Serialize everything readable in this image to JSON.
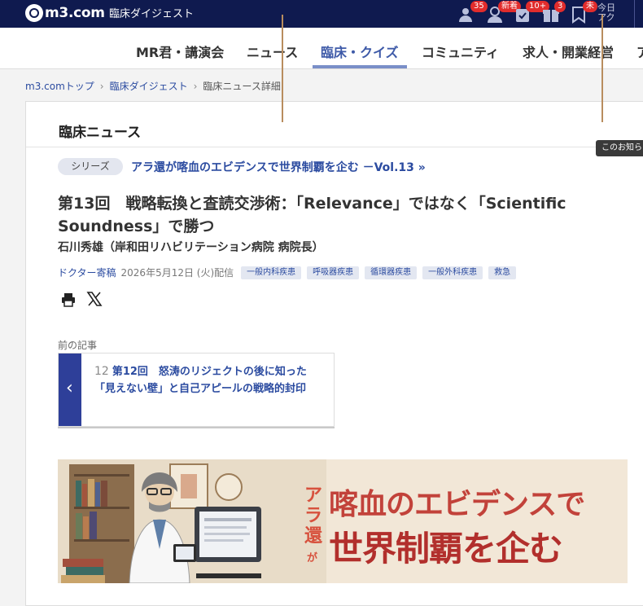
{
  "header": {
    "logo_text": "m3.com",
    "section_label": "臨床ダイジェスト",
    "icons": [
      {
        "name": "recommend-icon",
        "badge": "35"
      },
      {
        "name": "new-icon",
        "badge": "新着"
      },
      {
        "name": "check-icon",
        "badge": "10+"
      },
      {
        "name": "gift-icon",
        "badge": "3"
      },
      {
        "name": "bookmark-icon",
        "badge": "未"
      }
    ],
    "today_label": "今日\nアク",
    "badge_color": "#e12c2c"
  },
  "nav": {
    "items": [
      {
        "label": "MR君・講演会"
      },
      {
        "label": "ニュース"
      },
      {
        "label": "臨床・クイズ",
        "active": true
      },
      {
        "label": "コミュニティ"
      },
      {
        "label": "求人・開業経営"
      },
      {
        "label": "ア"
      }
    ],
    "active_color": "#3e5aa8"
  },
  "breadcrumb": {
    "items": [
      "m3.comトップ",
      "臨床ダイジェスト",
      "臨床ニュース詳細"
    ]
  },
  "card": {
    "title": "臨床ニュース",
    "notice_tab": "このお知ら"
  },
  "article": {
    "series_pill": "シリーズ",
    "series_link": "アラ還が喀血のエビデンスで世界制覇を企む －Vol.13 »",
    "title": "第13回　戦略転換と査読交渉術：「Relevance」ではなく「Scientific Soundness」で勝つ",
    "author": "石川秀雄（岸和田リハビリテーション病院 病院長）",
    "source": "ドクター寄稿",
    "date": "2026年5月12日 (火)配信",
    "tags": [
      "一般内科疾患",
      "呼吸器疾患",
      "循環器疾患",
      "一般外科疾患",
      "救急"
    ]
  },
  "previous": {
    "label": "前の記事",
    "number": "12",
    "title": "第12回　怒涛のリジェクトの後に知った「見えない壁」と自己アピールの戦略的封印"
  },
  "banner": {
    "side_text": "アラ還",
    "ga_text": "が",
    "line1": "喀血のエビデンスで",
    "line2": "世界制覇を企む",
    "background": "#f2e7d7"
  }
}
